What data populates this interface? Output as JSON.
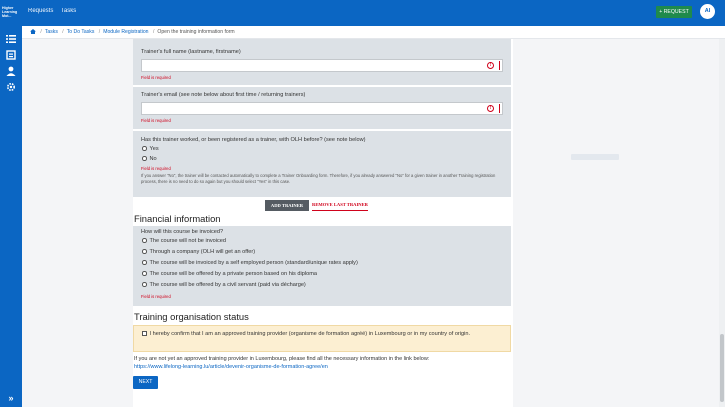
{
  "brand": {
    "line1": "Higher",
    "line2": "Learning",
    "line3": "Mot..."
  },
  "topnav": {
    "requests": "Requests",
    "tasks": "Tasks"
  },
  "request_button": "+ REQUEST",
  "avatar_initials": "AI",
  "breadcrumb": [
    "Tasks",
    "To Do Tasks",
    "Module Registration",
    "Open the training information form"
  ],
  "trainer": {
    "fullname_label": "Trainer's full name (lastname, firstname)",
    "fullname_value": "",
    "email_label": "Trainer's email (see note below about first time / returning trainers)",
    "email_value": "",
    "required_text": "Field is required",
    "worked_question": "Has this trainer worked, or been registered as a trainer, with OLH before? (see note below)",
    "worked_options": [
      "Yes",
      "No"
    ],
    "worked_note": "If you answer \"No\", the trainer will be contacted automatically to complete a Trainer Onboarding form. Therefore, if you already answered \"No\" for a given trainer in another Training registration process, there is no need to do so again but you should select \"Yes\" in this case.",
    "add_button": "ADD TRAINER",
    "remove_button": "REMOVE LAST TRAINER"
  },
  "financial": {
    "heading": "Financial information",
    "question": "How will this course be invoiced?",
    "options": [
      "The course will not be invoiced",
      "Through a company (OLH will get an offer)",
      "The course will be invoiced by a self employed person (standard/unique rates apply)",
      "The course will be offered by a private person based on his diploma",
      "The course will be offered by a civil servant (paid via décharge)"
    ],
    "required_text": "Field is required"
  },
  "organisation": {
    "heading": "Training organisation status",
    "confirm_text": "I hereby confirm that I am an approved training provider (organisme de formation agréé) in Luxembourg or in my country of origin.",
    "info_text": "If you are not yet an approved training provider in Luxembourg, please find all the necessary information in the link below:",
    "link": "https://www.lifelong-learning.lu/article/devenir-organisme-de-formation-agree/en"
  },
  "next_button": "NEXT",
  "colors": {
    "primary": "#0b66c3",
    "danger": "#d0021b",
    "success": "#1f8a4c",
    "panel": "#dce1e6",
    "warning_bg": "#fcefd2"
  },
  "icons": {
    "tasks": "list-icon",
    "user": "user-icon",
    "settings": "gear-icon",
    "home": "home-icon",
    "error": "alert-circle-icon",
    "expand": "double-chevron-right-icon"
  }
}
